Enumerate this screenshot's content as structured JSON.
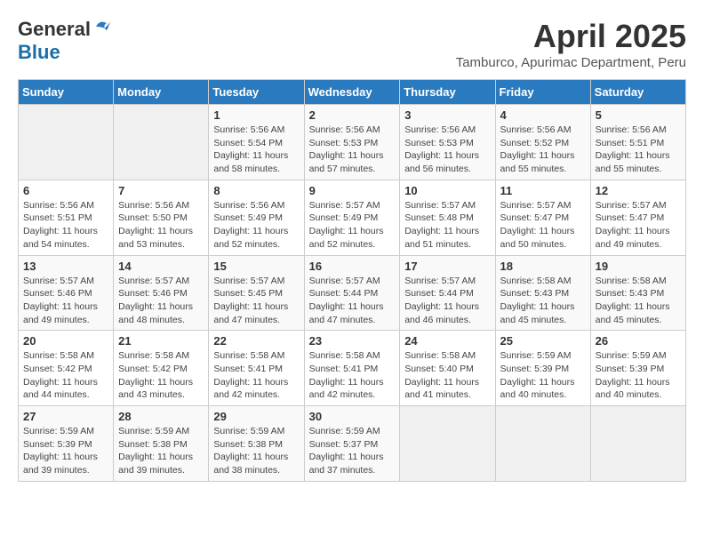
{
  "header": {
    "logo_general": "General",
    "logo_blue": "Blue",
    "title": "April 2025",
    "subtitle": "Tamburco, Apurimac Department, Peru"
  },
  "weekdays": [
    "Sunday",
    "Monday",
    "Tuesday",
    "Wednesday",
    "Thursday",
    "Friday",
    "Saturday"
  ],
  "weeks": [
    [
      {
        "day": "",
        "info": ""
      },
      {
        "day": "",
        "info": ""
      },
      {
        "day": "1",
        "info": "Sunrise: 5:56 AM\nSunset: 5:54 PM\nDaylight: 11 hours and 58 minutes."
      },
      {
        "day": "2",
        "info": "Sunrise: 5:56 AM\nSunset: 5:53 PM\nDaylight: 11 hours and 57 minutes."
      },
      {
        "day": "3",
        "info": "Sunrise: 5:56 AM\nSunset: 5:53 PM\nDaylight: 11 hours and 56 minutes."
      },
      {
        "day": "4",
        "info": "Sunrise: 5:56 AM\nSunset: 5:52 PM\nDaylight: 11 hours and 55 minutes."
      },
      {
        "day": "5",
        "info": "Sunrise: 5:56 AM\nSunset: 5:51 PM\nDaylight: 11 hours and 55 minutes."
      }
    ],
    [
      {
        "day": "6",
        "info": "Sunrise: 5:56 AM\nSunset: 5:51 PM\nDaylight: 11 hours and 54 minutes."
      },
      {
        "day": "7",
        "info": "Sunrise: 5:56 AM\nSunset: 5:50 PM\nDaylight: 11 hours and 53 minutes."
      },
      {
        "day": "8",
        "info": "Sunrise: 5:56 AM\nSunset: 5:49 PM\nDaylight: 11 hours and 52 minutes."
      },
      {
        "day": "9",
        "info": "Sunrise: 5:57 AM\nSunset: 5:49 PM\nDaylight: 11 hours and 52 minutes."
      },
      {
        "day": "10",
        "info": "Sunrise: 5:57 AM\nSunset: 5:48 PM\nDaylight: 11 hours and 51 minutes."
      },
      {
        "day": "11",
        "info": "Sunrise: 5:57 AM\nSunset: 5:47 PM\nDaylight: 11 hours and 50 minutes."
      },
      {
        "day": "12",
        "info": "Sunrise: 5:57 AM\nSunset: 5:47 PM\nDaylight: 11 hours and 49 minutes."
      }
    ],
    [
      {
        "day": "13",
        "info": "Sunrise: 5:57 AM\nSunset: 5:46 PM\nDaylight: 11 hours and 49 minutes."
      },
      {
        "day": "14",
        "info": "Sunrise: 5:57 AM\nSunset: 5:46 PM\nDaylight: 11 hours and 48 minutes."
      },
      {
        "day": "15",
        "info": "Sunrise: 5:57 AM\nSunset: 5:45 PM\nDaylight: 11 hours and 47 minutes."
      },
      {
        "day": "16",
        "info": "Sunrise: 5:57 AM\nSunset: 5:44 PM\nDaylight: 11 hours and 47 minutes."
      },
      {
        "day": "17",
        "info": "Sunrise: 5:57 AM\nSunset: 5:44 PM\nDaylight: 11 hours and 46 minutes."
      },
      {
        "day": "18",
        "info": "Sunrise: 5:58 AM\nSunset: 5:43 PM\nDaylight: 11 hours and 45 minutes."
      },
      {
        "day": "19",
        "info": "Sunrise: 5:58 AM\nSunset: 5:43 PM\nDaylight: 11 hours and 45 minutes."
      }
    ],
    [
      {
        "day": "20",
        "info": "Sunrise: 5:58 AM\nSunset: 5:42 PM\nDaylight: 11 hours and 44 minutes."
      },
      {
        "day": "21",
        "info": "Sunrise: 5:58 AM\nSunset: 5:42 PM\nDaylight: 11 hours and 43 minutes."
      },
      {
        "day": "22",
        "info": "Sunrise: 5:58 AM\nSunset: 5:41 PM\nDaylight: 11 hours and 42 minutes."
      },
      {
        "day": "23",
        "info": "Sunrise: 5:58 AM\nSunset: 5:41 PM\nDaylight: 11 hours and 42 minutes."
      },
      {
        "day": "24",
        "info": "Sunrise: 5:58 AM\nSunset: 5:40 PM\nDaylight: 11 hours and 41 minutes."
      },
      {
        "day": "25",
        "info": "Sunrise: 5:59 AM\nSunset: 5:39 PM\nDaylight: 11 hours and 40 minutes."
      },
      {
        "day": "26",
        "info": "Sunrise: 5:59 AM\nSunset: 5:39 PM\nDaylight: 11 hours and 40 minutes."
      }
    ],
    [
      {
        "day": "27",
        "info": "Sunrise: 5:59 AM\nSunset: 5:39 PM\nDaylight: 11 hours and 39 minutes."
      },
      {
        "day": "28",
        "info": "Sunrise: 5:59 AM\nSunset: 5:38 PM\nDaylight: 11 hours and 39 minutes."
      },
      {
        "day": "29",
        "info": "Sunrise: 5:59 AM\nSunset: 5:38 PM\nDaylight: 11 hours and 38 minutes."
      },
      {
        "day": "30",
        "info": "Sunrise: 5:59 AM\nSunset: 5:37 PM\nDaylight: 11 hours and 37 minutes."
      },
      {
        "day": "",
        "info": ""
      },
      {
        "day": "",
        "info": ""
      },
      {
        "day": "",
        "info": ""
      }
    ]
  ]
}
